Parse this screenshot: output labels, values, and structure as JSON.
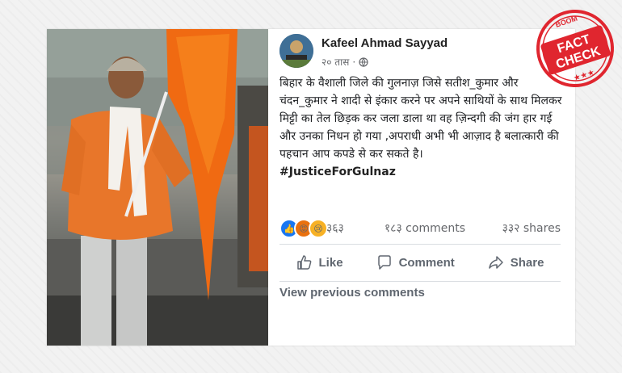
{
  "post": {
    "author": "Kafeel Ahmad Sayyad",
    "time": "२० तास",
    "text": "बिहार के वैशाली जिले की गुलनाज़ जिसे सतीश_कुमार और चंदन_कुमार ने शादी से इंकार करने पर अपने साथियों के साथ मिलकर मिट्टी का तेल छिड़क कर जला डाला था वह ज़िन्दगी की जंग हार गई और उनका निधन हो गया ,अपराधी अभी भी आज़ाद है बलात्कारी की पहचान आप कपडे से कर सकते है।",
    "hashtag": "#JusticeForGulnaz",
    "reaction_count": "३६३",
    "comments": "१८३ comments",
    "shares": "३३२ shares",
    "actions": {
      "like": "Like",
      "comment": "Comment",
      "share": "Share"
    },
    "view_previous": "View previous comments"
  },
  "stamp": {
    "top": "BOOM",
    "line1": "FACT",
    "line2": "CHECK",
    "color": "#e0262f"
  },
  "icons": {
    "globe": "globe-icon",
    "like": "thumbs-up-icon",
    "comment": "speech-bubble-icon",
    "share": "share-arrow-icon",
    "reactions": [
      "like-reaction-icon",
      "angry-reaction-icon",
      "sad-reaction-icon"
    ]
  }
}
